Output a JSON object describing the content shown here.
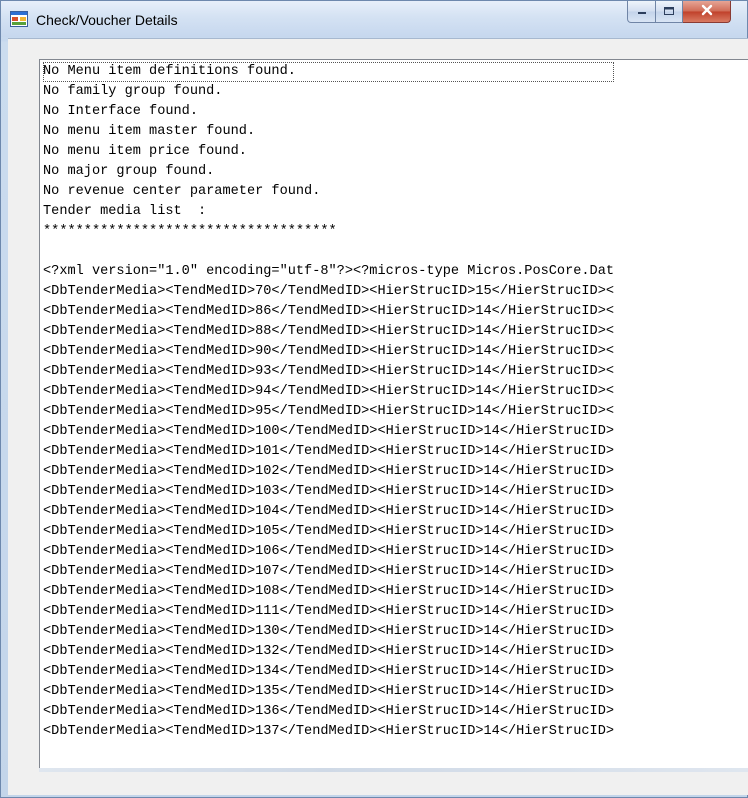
{
  "window": {
    "title": "Check/Voucher Details",
    "icon": "form-window-icon",
    "buttons": {
      "minimize": "minimize-icon",
      "maximize": "maximize-icon",
      "close": "close-icon"
    }
  },
  "text_content": {
    "lines": [
      "No Menu item definitions found.",
      "No family group found.",
      "No Interface found.",
      "No menu item master found.",
      "No menu item price found.",
      "No major group found.",
      "No revenue center parameter found.",
      "Tender media list  :",
      "************************************",
      "",
      "<?xml version=\"1.0\" encoding=\"utf-8\"?><?micros-type Micros.PosCore.Dat",
      "<DbTenderMedia><TendMedID>70</TendMedID><HierStrucID>15</HierStrucID><",
      "<DbTenderMedia><TendMedID>86</TendMedID><HierStrucID>14</HierStrucID><",
      "<DbTenderMedia><TendMedID>88</TendMedID><HierStrucID>14</HierStrucID><",
      "<DbTenderMedia><TendMedID>90</TendMedID><HierStrucID>14</HierStrucID><",
      "<DbTenderMedia><TendMedID>93</TendMedID><HierStrucID>14</HierStrucID><",
      "<DbTenderMedia><TendMedID>94</TendMedID><HierStrucID>14</HierStrucID><",
      "<DbTenderMedia><TendMedID>95</TendMedID><HierStrucID>14</HierStrucID><",
      "<DbTenderMedia><TendMedID>100</TendMedID><HierStrucID>14</HierStrucID>",
      "<DbTenderMedia><TendMedID>101</TendMedID><HierStrucID>14</HierStrucID>",
      "<DbTenderMedia><TendMedID>102</TendMedID><HierStrucID>14</HierStrucID>",
      "<DbTenderMedia><TendMedID>103</TendMedID><HierStrucID>14</HierStrucID>",
      "<DbTenderMedia><TendMedID>104</TendMedID><HierStrucID>14</HierStrucID>",
      "<DbTenderMedia><TendMedID>105</TendMedID><HierStrucID>14</HierStrucID>",
      "<DbTenderMedia><TendMedID>106</TendMedID><HierStrucID>14</HierStrucID>",
      "<DbTenderMedia><TendMedID>107</TendMedID><HierStrucID>14</HierStrucID>",
      "<DbTenderMedia><TendMedID>108</TendMedID><HierStrucID>14</HierStrucID>",
      "<DbTenderMedia><TendMedID>111</TendMedID><HierStrucID>14</HierStrucID>",
      "<DbTenderMedia><TendMedID>130</TendMedID><HierStrucID>14</HierStrucID>",
      "<DbTenderMedia><TendMedID>132</TendMedID><HierStrucID>14</HierStrucID>",
      "<DbTenderMedia><TendMedID>134</TendMedID><HierStrucID>14</HierStrucID>",
      "<DbTenderMedia><TendMedID>135</TendMedID><HierStrucID>14</HierStrucID>",
      "<DbTenderMedia><TendMedID>136</TendMedID><HierStrucID>14</HierStrucID>",
      "<DbTenderMedia><TendMedID>137</TendMedID><HierStrucID>14</HierStrucID>"
    ]
  }
}
